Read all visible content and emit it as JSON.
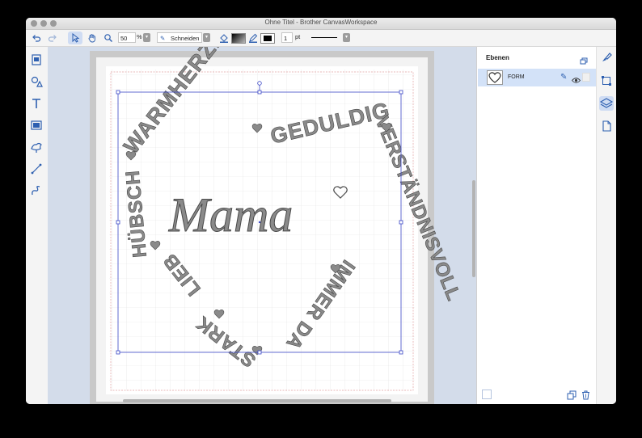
{
  "window": {
    "title": "Ohne Titel - Brother CanvasWorkspace"
  },
  "toolbar": {
    "zoom_value": "50",
    "zoom_unit": "%",
    "mode_label": "Schneiden",
    "line_width_value": "1",
    "line_width_unit": "pt"
  },
  "design": {
    "center_word": "Mama",
    "words": [
      "WARMHERZIG",
      "GEDULDIG",
      "VERSTÄNDNISVOLL",
      "IMMER DA",
      "STARK",
      "LIEB",
      "HÜBSCH"
    ]
  },
  "layers_panel": {
    "title": "Ebenen",
    "layers": [
      {
        "name": "FORM"
      }
    ]
  },
  "colors": {
    "accent": "#2d5fb0",
    "selection": "#d3e2f8",
    "canvas_bg": "#d3dcea",
    "text_fill": "#8a8a8a"
  },
  "icons": {
    "left": [
      "pattern-icon",
      "shapes-icon",
      "text-icon",
      "image-trace-icon",
      "bird-shape-icon",
      "line-icon",
      "freehand-icon"
    ],
    "right": [
      "paint-icon",
      "transform-icon",
      "layers-icon",
      "page-icon"
    ]
  }
}
